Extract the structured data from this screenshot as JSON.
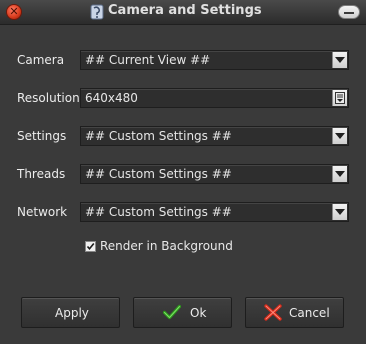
{
  "window": {
    "title": "Camera and Settings"
  },
  "rows": [
    {
      "label": "Camera",
      "value": "## Current View ##"
    },
    {
      "label": "Resolution",
      "value": "640x480"
    },
    {
      "label": "Settings",
      "value": "## Custom Settings ##"
    },
    {
      "label": "Threads",
      "value": "## Custom Settings ##"
    },
    {
      "label": "Network",
      "value": "## Custom Settings ##"
    }
  ],
  "render_background": {
    "label": "Render in Background",
    "checked": true
  },
  "buttons": {
    "apply": "Apply",
    "ok": "Ok",
    "cancel": "Cancel"
  },
  "colors": {
    "ok_check": "#2e9a1c",
    "cancel_x": "#d42a1a",
    "close_button": "#d63a1c"
  },
  "icons": {
    "close": "close-icon",
    "minimize": "minimize-icon",
    "app": "app-icon",
    "ok": "check-icon",
    "cancel": "x-icon"
  }
}
